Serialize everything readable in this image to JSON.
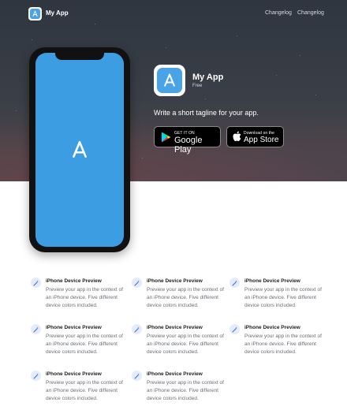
{
  "nav": {
    "brand": "My App",
    "links": [
      "Changelog",
      "Changelog"
    ]
  },
  "app": {
    "title": "My App",
    "price": "Free",
    "tagline": "Write a short tagline for your app.",
    "accent_color": "#4aa3e6"
  },
  "store_buttons": {
    "google_play": {
      "small": "GET IT ON",
      "big": "Google Play"
    },
    "app_store": {
      "small": "Download on the",
      "big": "App Store"
    }
  },
  "features": [
    {
      "title": "iPhone Device Preview",
      "description": "Preview your app in the context of an iPhone device. Five different device colors included."
    },
    {
      "title": "iPhone Device Preview",
      "description": "Preview your app in the context of an iPhone device. Five different device colors included."
    },
    {
      "title": "iPhone Device Preview",
      "description": "Preview your app in the context of an iPhone device. Five different device colors included."
    },
    {
      "title": "iPhone Device Preview",
      "description": "Preview your app in the context of an iPhone device. Five different device colors included."
    },
    {
      "title": "iPhone Device Preview",
      "description": "Preview your app in the context of an iPhone device. Five different device colors included."
    },
    {
      "title": "iPhone Device Preview",
      "description": "Preview your app in the context of an iPhone device. Five different device colors included."
    },
    {
      "title": "iPhone Device Preview",
      "description": "Preview your app in the context of an iPhone device. Five different device colors included."
    },
    {
      "title": "iPhone Device Preview",
      "description": "Preview your app in the context of an iPhone device. Five different device colors included."
    }
  ],
  "icons": {
    "app": "app-store-a-icon",
    "feature": "magic-wand-icon",
    "google_play": "google-play-triangle-icon",
    "app_store": "apple-logo-icon"
  }
}
